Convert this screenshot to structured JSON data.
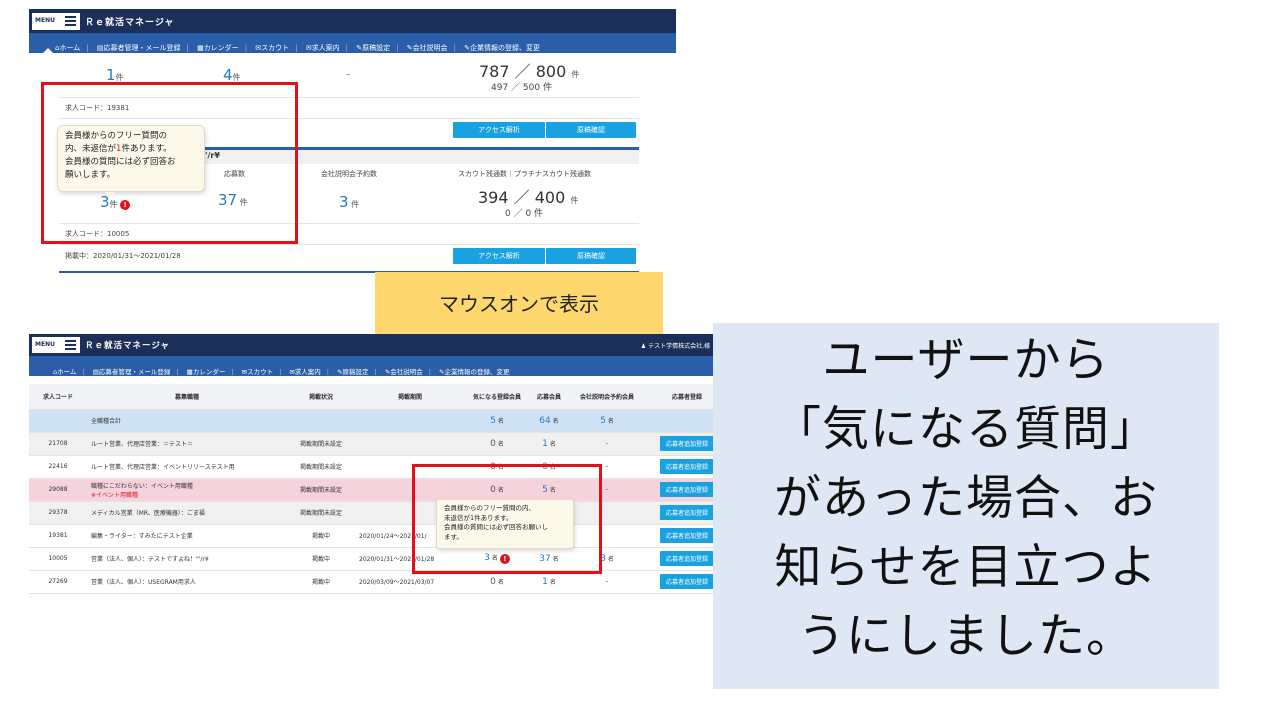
{
  "screenshot1": {
    "menu_label": "MENU",
    "app_title": "Ｒｅ就活マネージャ",
    "nav": [
      "ホーム",
      "応募者管理・メール登録",
      "カレンダー",
      "スカウト",
      "求人案内",
      "原稿設定",
      "会社説明会",
      "企業情報の登録、変更"
    ],
    "top_row": {
      "col1_num": "1",
      "col1_unit": "件",
      "col2_num": "4",
      "col2_unit": "件",
      "col3": "–",
      "scout_main": "787 ／ 800",
      "scout_main_unit": "件",
      "scout_sub": "497 ／ 500 件"
    },
    "job_code_1": "求人コード：19381",
    "btn_analysis": "アクセス解析",
    "btn_manuscript": "原稿確認",
    "section_title_fragment": "'/r¥",
    "headers": {
      "applications": "応募数",
      "briefing": "会社説明会予約数",
      "scout": "スカウト残通数｜プラチナスカウト残通数"
    },
    "row2": {
      "q_num": "3",
      "q_unit": "件",
      "app_num": "37",
      "app_unit": "件",
      "brief_num": "3",
      "brief_unit": "件",
      "scout_main": "394 ／ 400",
      "scout_main_unit": "件",
      "scout_sub": "0 ／ 0 件"
    },
    "job_code_2": "求人コード：10005",
    "period": "掲載中：2020/01/31～2021/01/28",
    "tooltip": {
      "line1": "会員様からのフリー質問の",
      "line2_pre": "内、未返信が",
      "line2_num": "1",
      "line2_post": "件あります。",
      "line3": "会員様の質問には必ず回答お",
      "line4": "願いします。"
    },
    "alert_mark": "!"
  },
  "callout_yellow": "マウスオンで表示",
  "screenshot2": {
    "menu_label": "MENU",
    "app_title": "Ｒｅ就活マネージャ",
    "user_label": "テスト学情株式会社,様",
    "nav": [
      "ホーム",
      "応募者管理・メール登録",
      "カレンダー",
      "スカウト",
      "求人案内",
      "原稿設定",
      "会社説明会",
      "企業情報の登録、変更"
    ],
    "columns": [
      "求人コード",
      "募集職種",
      "掲載状況",
      "掲載期間",
      "気になる登録会員",
      "応募会員",
      "会社説明会予約会員",
      "応募者登録"
    ],
    "total_row": {
      "label": "全職種合計",
      "interest": "5",
      "applicants": "64",
      "briefing": "5"
    },
    "rows": [
      {
        "code": "21708",
        "job": "ルート営業、代理店営業：＝テスト＝",
        "note": "",
        "status": "掲載期間未設定",
        "period": "",
        "interest": "0",
        "applicants": "1",
        "briefing": "–",
        "style": "grey",
        "alert": false
      },
      {
        "code": "22416",
        "job": "ルート営業、代理店営業：イベントリリーステスト用",
        "note": "",
        "status": "掲載期間未設定",
        "period": "",
        "interest": "0",
        "applicants": "0",
        "briefing": "–",
        "style": "",
        "alert": false
      },
      {
        "code": "29088",
        "job": "職種にこだわらない：イベント用職種",
        "note": "※イベント用職種",
        "status": "掲載期間未設定",
        "period": "",
        "interest": "0",
        "applicants": "5",
        "briefing": "–",
        "style": "pink",
        "alert": false
      },
      {
        "code": "29378",
        "job": "メディカル営業（MR、医療機器）：ごま福",
        "note": "",
        "status": "掲載期間未設定",
        "period": "",
        "interest": "",
        "applicants": "",
        "briefing": "",
        "style": "grey",
        "alert": false
      },
      {
        "code": "19381",
        "job": "編集・ライター：すみたにテスト企業",
        "note": "",
        "status": "掲載中",
        "period": "2020/01/24～2021/01/",
        "interest": "",
        "applicants": "",
        "briefing": "",
        "style": "",
        "alert": false
      },
      {
        "code": "10005",
        "job": "営業（法人、個人）：テストですよね！\"'/r¥",
        "note": "",
        "status": "掲載中",
        "period": "2020/01/31～2021/01/28",
        "interest": "3",
        "applicants": "37",
        "briefing": "3",
        "style": "",
        "alert": true
      },
      {
        "code": "27269",
        "job": "営業（法人、個人）：USEGRAM用求人",
        "note": "",
        "status": "掲載中",
        "period": "2020/03/09～2021/03/07",
        "interest": "0",
        "applicants": "1",
        "briefing": "–",
        "style": "",
        "alert": false
      }
    ],
    "unit": "名",
    "add_button": "応募者追加登録",
    "tooltip": {
      "line1": "会員様からのフリー質問の内、",
      "line2": "未返信が1件あります。",
      "line3": "会員様の質問には必ず回答お願いし",
      "line4": "ます。"
    }
  },
  "callout_blue": [
    "ユーザーから",
    "「気になる質問」",
    "があった場合、お",
    "知らせを目立つよ",
    "うにしました。"
  ]
}
